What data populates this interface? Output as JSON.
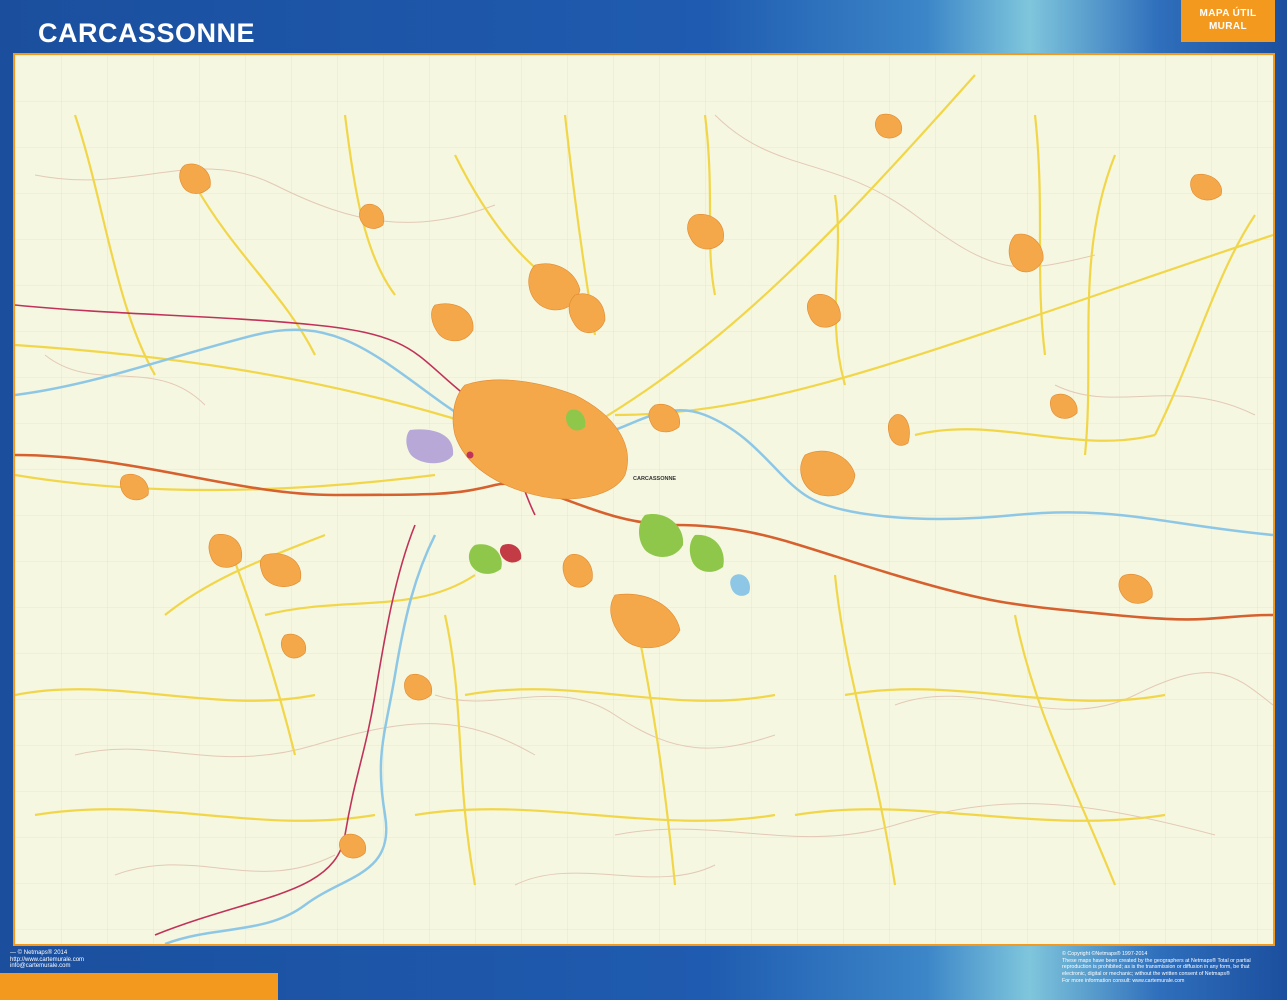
{
  "header": {
    "title": "CARCASSONNE",
    "badge_line1": "MAPA ÚTIL",
    "badge_line2": "MURAL"
  },
  "colors": {
    "frame_blue": "#1f56a8",
    "accent_orange": "#f39a1e",
    "map_background": "#f5f7e0",
    "urban_area": "#f4a84a",
    "major_road": "#f2d64a",
    "motorway": "#d6602e",
    "river": "#8ec7e6",
    "railway": "#c0325a",
    "green_area": "#8ec74a"
  },
  "map": {
    "city_label": "CARCASSONNE",
    "icons": [
      "city-pin-icon"
    ]
  },
  "footer": {
    "left_lines": [
      "—  © Netmaps® 2014",
      "http://www.cartemurale.com",
      "info@cartemurale.com"
    ],
    "right_lines": [
      "© Copyright ©Netmaps® 1997-2014",
      "These maps have been created by the geographers at Netmaps® Total or partial",
      "reproduction is prohibited; as is the transmission or diffusion in any form, be that",
      "electronic, digital or mechanic; without the written consent of Netmaps®",
      "For more information consult: www.cartemurale.com"
    ]
  }
}
